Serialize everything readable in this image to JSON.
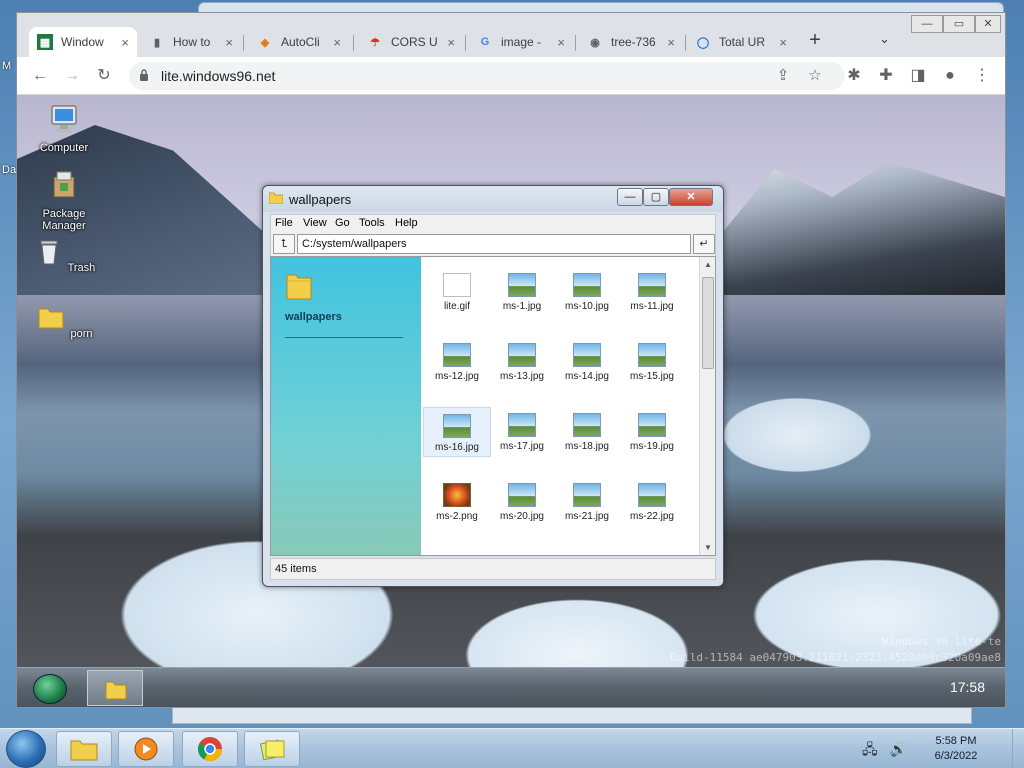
{
  "host_desktop": {
    "edge_labels": [
      "M",
      "Da"
    ]
  },
  "chrome": {
    "tabs": [
      {
        "title": "Window",
        "favicon": "windows96-icon",
        "close": "×"
      },
      {
        "title": "How to",
        "favicon": "doc-icon",
        "close": "×"
      },
      {
        "title": "AutoCli",
        "favicon": "autoclick-icon",
        "close": "×"
      },
      {
        "title": "CORS U",
        "favicon": "cors-icon",
        "close": "×"
      },
      {
        "title": "image -",
        "favicon": "google-icon",
        "close": "×"
      },
      {
        "title": "tree-736",
        "favicon": "globe-icon",
        "close": "×"
      },
      {
        "title": "Total UR",
        "favicon": "totalurl-icon",
        "close": "×"
      }
    ],
    "new_tab": "+",
    "tab_search": "⌄",
    "url": "lite.windows96.net",
    "window_controls": {
      "minimize": "—",
      "maximize": "▭",
      "close": "✕"
    }
  },
  "w96_desktop": {
    "icons": [
      {
        "label": "Computer",
        "icon": "computer-icon"
      },
      {
        "label": "Package Manager",
        "icon": "package-manager-icon"
      },
      {
        "label": "Trash",
        "icon": "trash-icon"
      },
      {
        "label": "porn",
        "icon": "folder-icon"
      }
    ],
    "watermark_line1": "Windows 96 lite-te",
    "watermark_line2": "Build-11584 ae047903.211021-2323.4520e09c320a09ae8",
    "clock": "17:58"
  },
  "explorer": {
    "title": "wallpapers",
    "controls": {
      "minimize": "—",
      "maximize": "▢",
      "close": "✕"
    },
    "menu": [
      "File",
      "View",
      "Go",
      "Tools",
      "Help"
    ],
    "address": "C:/system/wallpapers",
    "back_symbol": "⮤",
    "go_symbol": "↵",
    "sidebar_title": "wallpapers",
    "files": [
      {
        "name": "lite.gif",
        "kind": "gif"
      },
      {
        "name": "ms-1.jpg",
        "kind": "img"
      },
      {
        "name": "ms-10.jpg",
        "kind": "img"
      },
      {
        "name": "ms-11.jpg",
        "kind": "img"
      },
      {
        "name": "ms-12.jpg",
        "kind": "img"
      },
      {
        "name": "ms-13.jpg",
        "kind": "img"
      },
      {
        "name": "ms-14.jpg",
        "kind": "img"
      },
      {
        "name": "ms-15.jpg",
        "kind": "img"
      },
      {
        "name": "ms-16.jpg",
        "kind": "img",
        "selected": true
      },
      {
        "name": "ms-17.jpg",
        "kind": "img"
      },
      {
        "name": "ms-18.jpg",
        "kind": "img"
      },
      {
        "name": "ms-19.jpg",
        "kind": "img"
      },
      {
        "name": "ms-2.png",
        "kind": "png"
      },
      {
        "name": "ms-20.jpg",
        "kind": "img"
      },
      {
        "name": "ms-21.jpg",
        "kind": "img"
      },
      {
        "name": "ms-22.jpg",
        "kind": "img"
      }
    ],
    "status": "45 items"
  },
  "host_taskbar": {
    "clock_time": "5:58 PM",
    "clock_date": "6/3/2022",
    "tray_icons": [
      "network-icon",
      "volume-icon"
    ]
  },
  "colors": {
    "explorer_sidebar": "#41c3df",
    "close_button": "#c74431",
    "chrome_tab_bg": "#dee1e6"
  }
}
